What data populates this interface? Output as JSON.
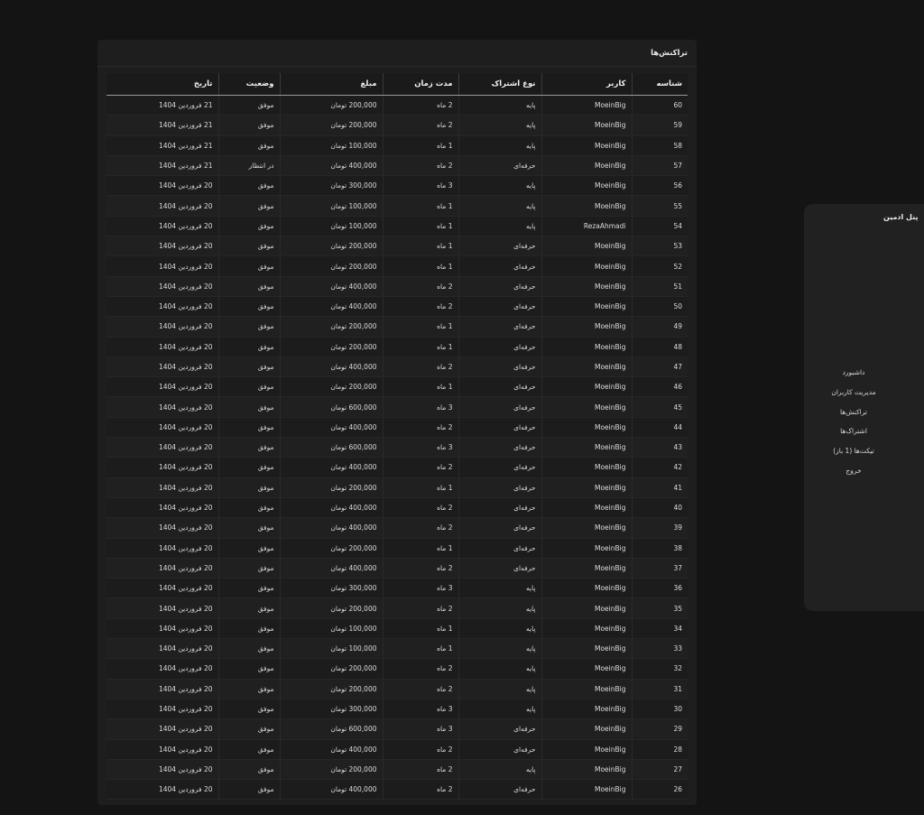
{
  "transactions": {
    "title": "تراکنش‌ها",
    "headers": [
      "شناسه",
      "کاربر",
      "نوع اشتراک",
      "مدت زمان",
      "مبلغ",
      "وضعیت",
      "تاریخ"
    ],
    "rows": [
      [
        "60",
        "MoeinBig",
        "پایه",
        "2 ماه",
        "200,000 تومان",
        "موفق",
        "21 فروردین 1404"
      ],
      [
        "59",
        "MoeinBig",
        "پایه",
        "2 ماه",
        "200,000 تومان",
        "موفق",
        "21 فروردین 1404"
      ],
      [
        "58",
        "MoeinBig",
        "پایه",
        "1 ماه",
        "100,000 تومان",
        "موفق",
        "21 فروردین 1404"
      ],
      [
        "57",
        "MoeinBig",
        "حرفه‌ای",
        "2 ماه",
        "400,000 تومان",
        "در انتظار",
        "21 فروردین 1404"
      ],
      [
        "56",
        "MoeinBig",
        "پایه",
        "3 ماه",
        "300,000 تومان",
        "موفق",
        "20 فروردین 1404"
      ],
      [
        "55",
        "MoeinBig",
        "پایه",
        "1 ماه",
        "100,000 تومان",
        "موفق",
        "20 فروردین 1404"
      ],
      [
        "54",
        "RezaAhmadi",
        "پایه",
        "1 ماه",
        "100,000 تومان",
        "موفق",
        "20 فروردین 1404"
      ],
      [
        "53",
        "MoeinBig",
        "حرفه‌ای",
        "1 ماه",
        "200,000 تومان",
        "موفق",
        "20 فروردین 1404"
      ],
      [
        "52",
        "MoeinBig",
        "حرفه‌ای",
        "1 ماه",
        "200,000 تومان",
        "موفق",
        "20 فروردین 1404"
      ],
      [
        "51",
        "MoeinBig",
        "حرفه‌ای",
        "2 ماه",
        "400,000 تومان",
        "موفق",
        "20 فروردین 1404"
      ],
      [
        "50",
        "MoeinBig",
        "حرفه‌ای",
        "2 ماه",
        "400,000 تومان",
        "موفق",
        "20 فروردین 1404"
      ],
      [
        "49",
        "MoeinBig",
        "حرفه‌ای",
        "1 ماه",
        "200,000 تومان",
        "موفق",
        "20 فروردین 1404"
      ],
      [
        "48",
        "MoeinBig",
        "حرفه‌ای",
        "1 ماه",
        "200,000 تومان",
        "موفق",
        "20 فروردین 1404"
      ],
      [
        "47",
        "MoeinBig",
        "حرفه‌ای",
        "2 ماه",
        "400,000 تومان",
        "موفق",
        "20 فروردین 1404"
      ],
      [
        "46",
        "MoeinBig",
        "حرفه‌ای",
        "1 ماه",
        "200,000 تومان",
        "موفق",
        "20 فروردین 1404"
      ],
      [
        "45",
        "MoeinBig",
        "حرفه‌ای",
        "3 ماه",
        "600,000 تومان",
        "موفق",
        "20 فروردین 1404"
      ],
      [
        "44",
        "MoeinBig",
        "حرفه‌ای",
        "2 ماه",
        "400,000 تومان",
        "موفق",
        "20 فروردین 1404"
      ],
      [
        "43",
        "MoeinBig",
        "حرفه‌ای",
        "3 ماه",
        "600,000 تومان",
        "موفق",
        "20 فروردین 1404"
      ],
      [
        "42",
        "MoeinBig",
        "حرفه‌ای",
        "2 ماه",
        "400,000 تومان",
        "موفق",
        "20 فروردین 1404"
      ],
      [
        "41",
        "MoeinBig",
        "حرفه‌ای",
        "1 ماه",
        "200,000 تومان",
        "موفق",
        "20 فروردین 1404"
      ],
      [
        "40",
        "MoeinBig",
        "حرفه‌ای",
        "2 ماه",
        "400,000 تومان",
        "موفق",
        "20 فروردین 1404"
      ],
      [
        "39",
        "MoeinBig",
        "حرفه‌ای",
        "2 ماه",
        "400,000 تومان",
        "موفق",
        "20 فروردین 1404"
      ],
      [
        "38",
        "MoeinBig",
        "حرفه‌ای",
        "1 ماه",
        "200,000 تومان",
        "موفق",
        "20 فروردین 1404"
      ],
      [
        "37",
        "MoeinBig",
        "حرفه‌ای",
        "2 ماه",
        "400,000 تومان",
        "موفق",
        "20 فروردین 1404"
      ],
      [
        "36",
        "MoeinBig",
        "پایه",
        "3 ماه",
        "300,000 تومان",
        "موفق",
        "20 فروردین 1404"
      ],
      [
        "35",
        "MoeinBig",
        "پایه",
        "2 ماه",
        "200,000 تومان",
        "موفق",
        "20 فروردین 1404"
      ],
      [
        "34",
        "MoeinBig",
        "پایه",
        "1 ماه",
        "100,000 تومان",
        "موفق",
        "20 فروردین 1404"
      ],
      [
        "33",
        "MoeinBig",
        "پایه",
        "1 ماه",
        "100,000 تومان",
        "موفق",
        "20 فروردین 1404"
      ],
      [
        "32",
        "MoeinBig",
        "پایه",
        "2 ماه",
        "200,000 تومان",
        "موفق",
        "20 فروردین 1404"
      ],
      [
        "31",
        "MoeinBig",
        "پایه",
        "2 ماه",
        "200,000 تومان",
        "موفق",
        "20 فروردین 1404"
      ],
      [
        "30",
        "MoeinBig",
        "پایه",
        "3 ماه",
        "300,000 تومان",
        "موفق",
        "20 فروردین 1404"
      ],
      [
        "29",
        "MoeinBig",
        "حرفه‌ای",
        "3 ماه",
        "600,000 تومان",
        "موفق",
        "20 فروردین 1404"
      ],
      [
        "28",
        "MoeinBig",
        "حرفه‌ای",
        "2 ماه",
        "400,000 تومان",
        "موفق",
        "20 فروردین 1404"
      ],
      [
        "27",
        "MoeinBig",
        "پایه",
        "2 ماه",
        "200,000 تومان",
        "موفق",
        "20 فروردین 1404"
      ],
      [
        "26",
        "MoeinBig",
        "حرفه‌ای",
        "2 ماه",
        "400,000 تومان",
        "موفق",
        "20 فروردین 1404"
      ]
    ]
  },
  "sidebar": {
    "title": "پنل ادمین",
    "items": [
      {
        "label": "داشبورد",
        "name": "sidebar-item-dashboard"
      },
      {
        "label": "مدیریت کاربران",
        "name": "sidebar-item-users"
      },
      {
        "label": "تراکنش‌ها",
        "name": "sidebar-item-transactions"
      },
      {
        "label": "اشتراک‌ها",
        "name": "sidebar-item-subscriptions"
      },
      {
        "label": "تیکت‌ها (1 باز)",
        "name": "sidebar-item-tickets"
      },
      {
        "label": "خروج",
        "name": "sidebar-item-logout"
      }
    ]
  },
  "colors": {
    "background": "#141414",
    "panel": "#1e1e1e",
    "sidebar": "#212121",
    "text": "#e8e8e8"
  }
}
